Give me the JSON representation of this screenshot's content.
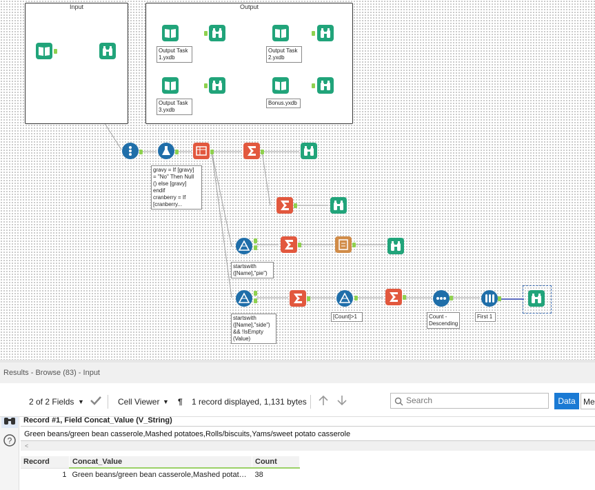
{
  "canvas": {
    "containers": {
      "input_title": "Input",
      "output_title": "Output"
    },
    "labels": {
      "out1": "Output Task\n1.yxdb",
      "out2": "Output Task\n2.yxdb",
      "out3": "Output Task\n3.yxdb",
      "out4": "Bonus.yxdb",
      "formula": "gravy = If [gravy]\n= \"No\" Then Null\n() else [gravy]\nendif\ncranberry = If\n[cranberry...",
      "filter1": "startswith\n([Name],\"pie\")",
      "filter2": "startswith\n([Name],\"side\")\n&& !IsEmpty\n(Value)",
      "filter3": "[Count]>1",
      "sort": "Count -\nDescending",
      "sample": "First 1"
    }
  },
  "results": {
    "title": "Results - Browse (83) - Input",
    "toolbar": {
      "fields": "2 of 2 Fields",
      "cell_viewer": "Cell Viewer",
      "records": "1 record displayed, 1,131 bytes",
      "search_placeholder": "Search",
      "data_tab": "Data",
      "meta_tab": "Me"
    },
    "record_header": "Record #1, Field Concat_Value (V_String)",
    "cell_value": "Green beans/green bean casserole,Mashed potatoes,Rolls/biscuits,Yams/sweet potato casserole",
    "grid": {
      "columns": [
        "Record",
        "Concat_Value",
        "Count"
      ],
      "rows": [
        {
          "record": "1",
          "concat": "Green beans/green bean casserole,Mashed potat…",
          "count": "38"
        }
      ]
    }
  },
  "colors": {
    "tool_green": "#21a47a",
    "summarize_red": "#e2583e",
    "anchor_green": "#8fd14f",
    "accent_blue": "#1a7ad4"
  }
}
